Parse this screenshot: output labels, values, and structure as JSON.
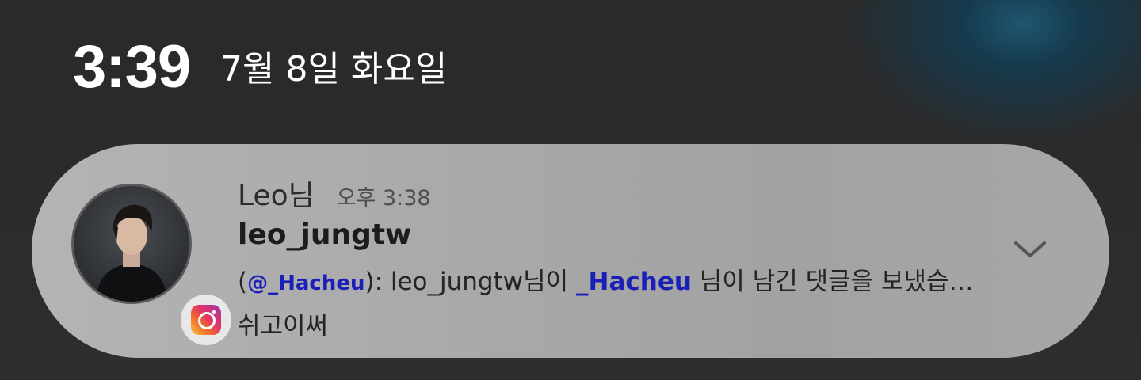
{
  "status": {
    "time": "3:39",
    "date": "7월 8일 화요일"
  },
  "notification": {
    "sender": "Leo님",
    "time": "오후 3:38",
    "username": "leo_jungtw",
    "message": {
      "open_paren": "(",
      "mention_handle": "@_Hacheu",
      "close_part": "): leo_jungtw님이 ",
      "mention_name": "_Hacheu",
      "tail": " 님이 남긴 댓글을 보냈습…"
    },
    "message_line2": "쉬고이써",
    "app_icon": "instagram-icon",
    "expand_icon": "chevron-down-icon"
  },
  "colors": {
    "mention": "#1a1fb8",
    "card": "#ababab",
    "background": "#2b2b2c"
  }
}
